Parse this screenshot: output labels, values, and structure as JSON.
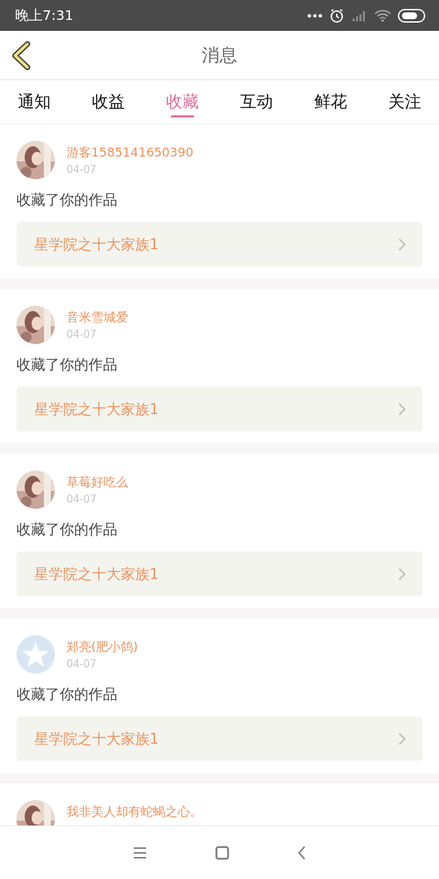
{
  "status_bar": {
    "time": "晚上7:31"
  },
  "header": {
    "title": "消息"
  },
  "tabs": [
    {
      "label": "通知",
      "selected": false
    },
    {
      "label": "收益",
      "selected": false
    },
    {
      "label": "收藏",
      "selected": true
    },
    {
      "label": "互动",
      "selected": false
    },
    {
      "label": "鲜花",
      "selected": false
    },
    {
      "label": "关注",
      "selected": false
    }
  ],
  "messages": [
    {
      "kind": "picture",
      "user": "游客1585141650390",
      "date": "04-07",
      "action": "收藏了你的作品",
      "work": "星学院之十大家族1"
    },
    {
      "kind": "picture",
      "user": "音米雪城爱",
      "date": "04-07",
      "action": "收藏了你的作品",
      "work": "星学院之十大家族1"
    },
    {
      "kind": "picture",
      "user": "草莓好吃么",
      "date": "04-07",
      "action": "收藏了你的作品",
      "work": "星学院之十大家族1"
    },
    {
      "kind": "default",
      "user": "郑亮(肥小鸽)",
      "date": "04-07",
      "action": "收藏了你的作品",
      "work": "星学院之十大家族1"
    },
    {
      "kind": "picture",
      "user": "我非美人却有蛇蝎之心。"
    }
  ]
}
